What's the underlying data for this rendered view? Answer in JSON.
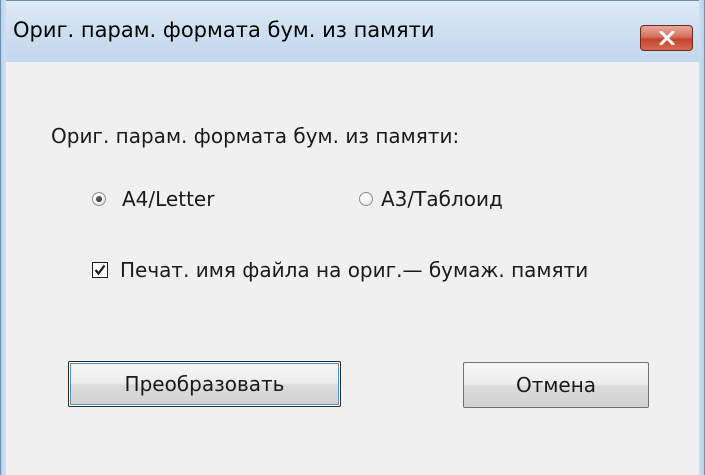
{
  "window": {
    "title": "Ориг. парам. формата бум. из памяти",
    "close_icon": "close-icon"
  },
  "dialog": {
    "prompt": "Ориг. парам. формата бум. из памяти:",
    "paper_options": [
      {
        "label": "A4/Letter",
        "selected": true
      },
      {
        "label": "A3/Таблоид",
        "selected": false
      }
    ],
    "print_filename": {
      "label": "Печат. имя файла на ориг.— бумаж. памяти",
      "checked": true
    }
  },
  "buttons": {
    "convert_label": "Преобразовать",
    "cancel_label": "Отмена"
  },
  "colors": {
    "close_button": "#c5432c",
    "dialog_background": "#f0f0f0",
    "frame": "#cfe0f1"
  }
}
